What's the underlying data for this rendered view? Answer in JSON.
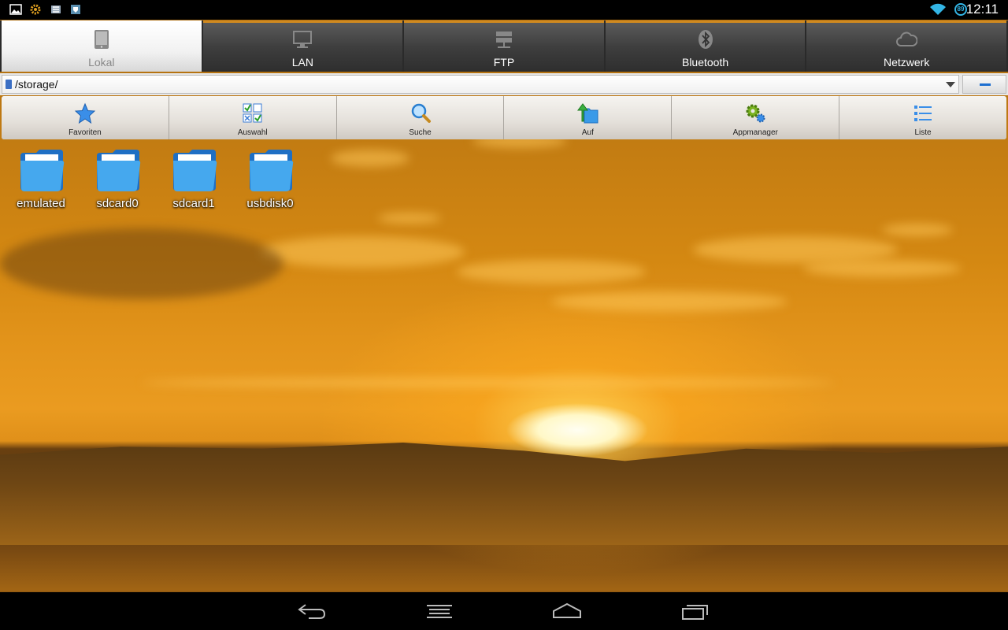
{
  "status_bar": {
    "icons": [
      "gallery-icon",
      "settings-icon",
      "app-icon",
      "shield-icon"
    ],
    "battery": "89",
    "time": "12:11"
  },
  "tabs": [
    {
      "label": "Lokal",
      "icon": "tablet-icon",
      "active": true
    },
    {
      "label": "LAN",
      "icon": "monitor-icon",
      "active": false
    },
    {
      "label": "FTP",
      "icon": "ftp-server-icon",
      "active": false
    },
    {
      "label": "Bluetooth",
      "icon": "bluetooth-icon",
      "active": false
    },
    {
      "label": "Netzwerk",
      "icon": "cloud-icon",
      "active": false
    }
  ],
  "path": {
    "value": "/storage/"
  },
  "toolbar": [
    {
      "label": "Favoriten",
      "icon": "star-icon"
    },
    {
      "label": "Auswahl",
      "icon": "checklist-grid-icon"
    },
    {
      "label": "Suche",
      "icon": "magnifier-icon"
    },
    {
      "label": "Auf",
      "icon": "folder-up-icon"
    },
    {
      "label": "Appmanager",
      "icon": "gears-icon"
    },
    {
      "label": "Liste",
      "icon": "list-view-icon"
    }
  ],
  "files": [
    {
      "name": "emulated",
      "icon": "folder-icon"
    },
    {
      "name": "sdcard0",
      "icon": "folder-icon"
    },
    {
      "name": "sdcard1",
      "icon": "folder-icon"
    },
    {
      "name": "usbdisk0",
      "icon": "folder-icon"
    }
  ],
  "nav_bar": {
    "icons": [
      "back-icon",
      "menu-icon",
      "home-icon",
      "recent-apps-icon"
    ]
  },
  "colors": {
    "accent": "#33b5e5",
    "folder_blue": "#3aa0e6",
    "tab_active_bg": "#f1f1f1",
    "tab_bg": "#3e3e3e"
  }
}
